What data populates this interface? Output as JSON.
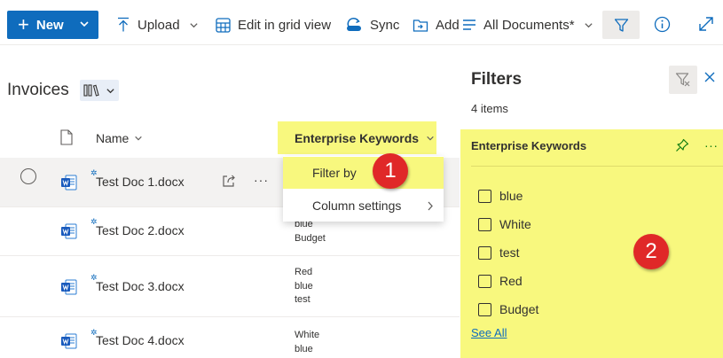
{
  "command_bar": {
    "new_label": "New",
    "upload_label": "Upload",
    "edit_grid_label": "Edit in grid view",
    "sync_label": "Sync",
    "add_label": "Add",
    "view_label": "All Documents*"
  },
  "library": {
    "title": "Invoices"
  },
  "columns": {
    "name": "Name",
    "keywords": "Enterprise Keywords"
  },
  "rows": [
    {
      "name": "Test Doc 1.docx",
      "keywords": []
    },
    {
      "name": "Test Doc 2.docx",
      "keywords": [
        "blue",
        "Budget"
      ]
    },
    {
      "name": "Test Doc 3.docx",
      "keywords": [
        "Red",
        "blue",
        "test"
      ]
    },
    {
      "name": "Test Doc 4.docx",
      "keywords": [
        "White",
        "blue"
      ]
    }
  ],
  "column_menu": {
    "filter_by": "Filter by",
    "column_settings": "Column settings"
  },
  "annotations": {
    "badge_1": "1",
    "badge_2": "2"
  },
  "filter_pane": {
    "title": "Filters",
    "count": "4 items",
    "section_title": "Enterprise Keywords",
    "options": [
      "blue",
      "White",
      "test",
      "Red",
      "Budget"
    ],
    "see_all": "See All"
  },
  "colors": {
    "accent": "#0f6cbd",
    "highlight": "#f8f87e",
    "badge": "#e02828",
    "pin_green": "#107c10"
  },
  "icons": [
    "plus-icon",
    "upload-icon",
    "grid-icon",
    "sync-icon",
    "add-shortcut-icon",
    "view-list-icon",
    "filter-icon",
    "info-icon",
    "expand-icon",
    "library-view-icon",
    "document-icon",
    "word-file-icon",
    "share-icon",
    "more-icon",
    "pin-icon",
    "clear-filter-icon",
    "close-icon"
  ]
}
